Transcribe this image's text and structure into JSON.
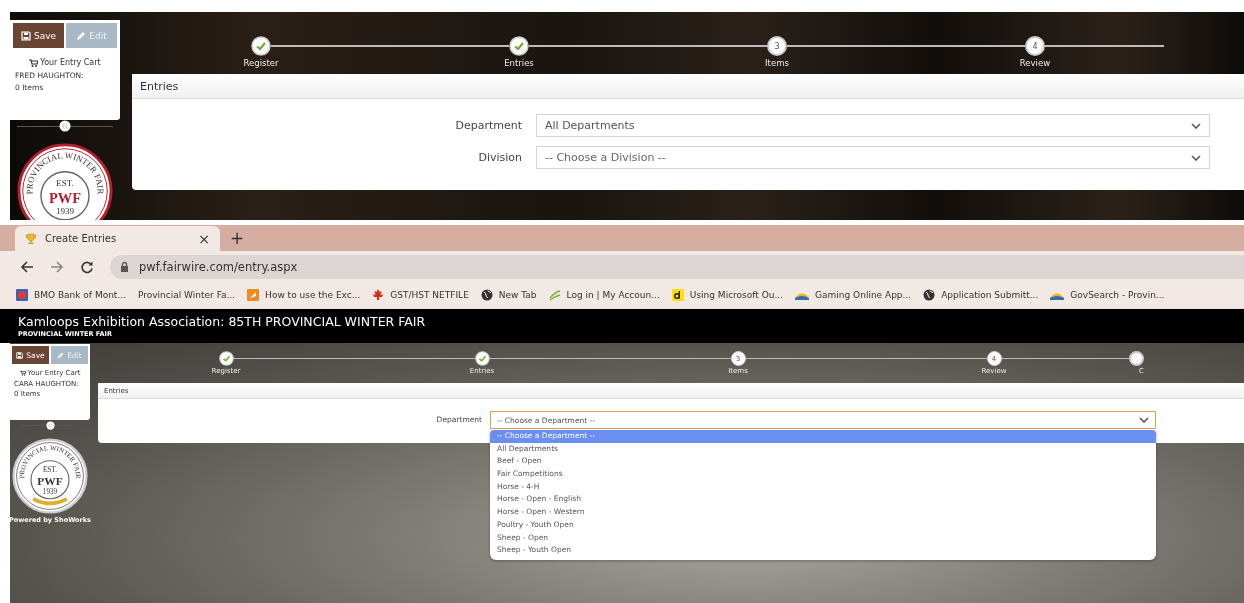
{
  "upper_page": {
    "cart": {
      "save_label": "Save",
      "edit_label": "Edit",
      "edit_disabled": true,
      "title": "Your Entry Cart",
      "owner": "FRED HAUGHTON:",
      "count": "0 Items"
    },
    "logo": {
      "ring_text": "PROVINCIAL WINTER FAIR",
      "est": "EST.",
      "initials": "PWF",
      "year": "1939"
    },
    "steps": [
      {
        "label": "Register",
        "done": true
      },
      {
        "label": "Entries",
        "done": true
      },
      {
        "number": "3",
        "label": "Items",
        "done": false
      },
      {
        "number": "4",
        "label": "Review",
        "done": false
      }
    ],
    "panel": {
      "title": "Entries",
      "fields": [
        {
          "label": "Department",
          "value": "All Departments"
        },
        {
          "label": "Division",
          "placeholder": "-- Choose a Division --"
        }
      ]
    }
  },
  "browser": {
    "tabs": [
      {
        "title": "Create Entries",
        "close": "×",
        "selected": true
      }
    ],
    "new_tab": "+",
    "url": "pwf.fairwire.com/entry.aspx",
    "bookmarks": [
      {
        "label": "BMO Bank of Mont...",
        "kind": "bank"
      },
      {
        "label": "Provincial Winter Fa...",
        "kind": "plain"
      },
      {
        "label": "How to use the Exc...",
        "kind": "flag"
      },
      {
        "label": "GST/HST NETFILE",
        "kind": "leaf"
      },
      {
        "label": "New Tab",
        "kind": "globe"
      },
      {
        "label": "Log in | My Accoun...",
        "kind": "swoosh"
      },
      {
        "label": "Using Microsoft Ou...",
        "kind": "letter"
      },
      {
        "label": "Gaming Online App...",
        "kind": "hill"
      },
      {
        "label": "Application Submitt...",
        "kind": "globe"
      },
      {
        "label": "GovSearch - Provin...",
        "kind": "hill"
      }
    ]
  },
  "lower_page": {
    "title": "Kamloops Exhibition Association: 85TH PROVINCIAL WINTER FAIR",
    "subtitle": "PROVINCIAL WINTER FAIR",
    "cart": {
      "save_label": "Save",
      "edit_label": "Edit",
      "edit_disabled": true,
      "title": "Your Entry Cart",
      "owner": "CARA HAUGHTON:",
      "count": "0 Items"
    },
    "logo": {
      "ring_text": "PROVINCIAL WINTER FAIR",
      "est": "EST.",
      "initials": "PWF",
      "year": "1939"
    },
    "powered_by": "Powered by ShoWorks",
    "steps": [
      {
        "label": "Register",
        "done": true
      },
      {
        "label": "Entries",
        "done": true
      },
      {
        "number": "3",
        "label": "Items",
        "done": false
      },
      {
        "number": "4",
        "label": "Review",
        "done": false
      },
      {
        "label": "C",
        "done": false
      }
    ],
    "panel": {
      "title": "Entries",
      "fields": [
        {
          "label": "Department",
          "value": "-- Choose a Department --",
          "open": true,
          "options": [
            {
              "label": "-- Choose a Department --",
              "selected": true
            },
            {
              "label": "All Departments",
              "selected": false
            },
            {
              "label": "Beef - Open",
              "selected": false
            },
            {
              "label": "Fair Competitions",
              "selected": false
            },
            {
              "label": "Horse - 4-H",
              "selected": false
            },
            {
              "label": "Horse - Open - English",
              "selected": false
            },
            {
              "label": "Horse - Open - Western",
              "selected": false
            },
            {
              "label": "Poultry - Youth Open",
              "selected": false
            },
            {
              "label": "Sheep - Open",
              "selected": false
            },
            {
              "label": "Sheep - Youth Open",
              "selected": false
            }
          ]
        }
      ]
    }
  }
}
